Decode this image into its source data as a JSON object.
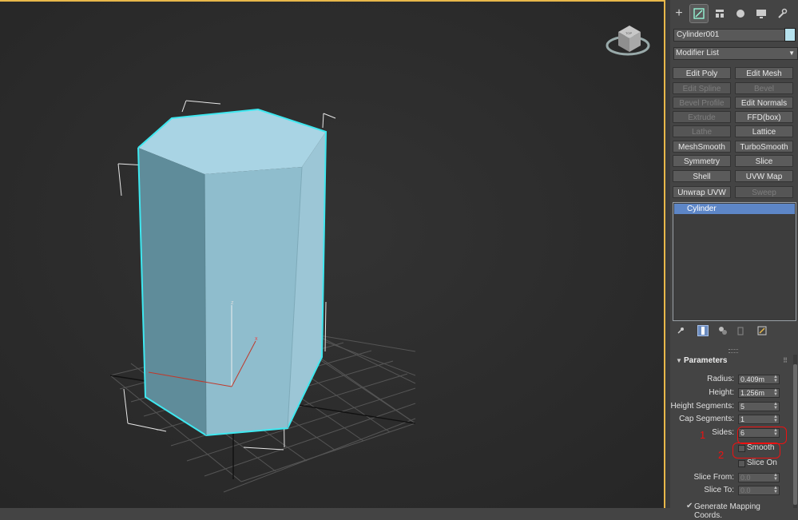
{
  "viewport": {
    "gizmo_label": "TOP",
    "axis_z": "z",
    "axis_x": "x",
    "object_color": "#a8d3e2",
    "selection_color": "#3ee8f0"
  },
  "tabs": [
    {
      "name": "create-tab",
      "icon": "+"
    },
    {
      "name": "modify-tab",
      "icon": "modify"
    },
    {
      "name": "hierarchy-tab",
      "icon": "hierarchy"
    },
    {
      "name": "motion-tab",
      "icon": "motion"
    },
    {
      "name": "display-tab",
      "icon": "display"
    },
    {
      "name": "utilities-tab",
      "icon": "wrench"
    }
  ],
  "object_name": "Cylinder001",
  "object_color": "#b7e2ee",
  "modifier_list": "Modifier List",
  "modifier_buttons": [
    {
      "label": "Edit Poly",
      "enabled": true
    },
    {
      "label": "Edit Mesh",
      "enabled": true
    },
    {
      "label": "Edit Spline",
      "enabled": false
    },
    {
      "label": "Bevel",
      "enabled": false
    },
    {
      "label": "Bevel Profile",
      "enabled": false
    },
    {
      "label": "Edit Normals",
      "enabled": true
    },
    {
      "label": "Extrude",
      "enabled": false
    },
    {
      "label": "FFD(box)",
      "enabled": true
    },
    {
      "label": "Lathe",
      "enabled": false
    },
    {
      "label": "Lattice",
      "enabled": true
    },
    {
      "label": "MeshSmooth",
      "enabled": true
    },
    {
      "label": "TurboSmooth",
      "enabled": true
    },
    {
      "label": "Symmetry",
      "enabled": true
    },
    {
      "label": "Slice",
      "enabled": true
    },
    {
      "label": "Shell",
      "enabled": true
    },
    {
      "label": "UVW Map",
      "enabled": true
    },
    {
      "label": "Unwrap UVW",
      "enabled": true
    },
    {
      "label": "Sweep",
      "enabled": false
    }
  ],
  "stack_item": "Cylinder",
  "parameters": {
    "title": "Parameters",
    "radius_label": "Radius:",
    "radius_value": "0.409m",
    "height_label": "Height:",
    "height_value": "1.256m",
    "height_segments_label": "Height Segments:",
    "height_segments_value": "5",
    "cap_segments_label": "Cap Segments:",
    "cap_segments_value": "1",
    "sides_label": "Sides:",
    "sides_value": "6",
    "smooth_label": "Smooth",
    "slice_on_label": "Slice On",
    "slice_from_label": "Slice From:",
    "slice_from_value": "0.0",
    "slice_to_label": "Slice To:",
    "slice_to_value": "0.0",
    "generate_mapping_label": "Generate Mapping Coords."
  },
  "annotations": {
    "one": "1",
    "two": "2"
  }
}
